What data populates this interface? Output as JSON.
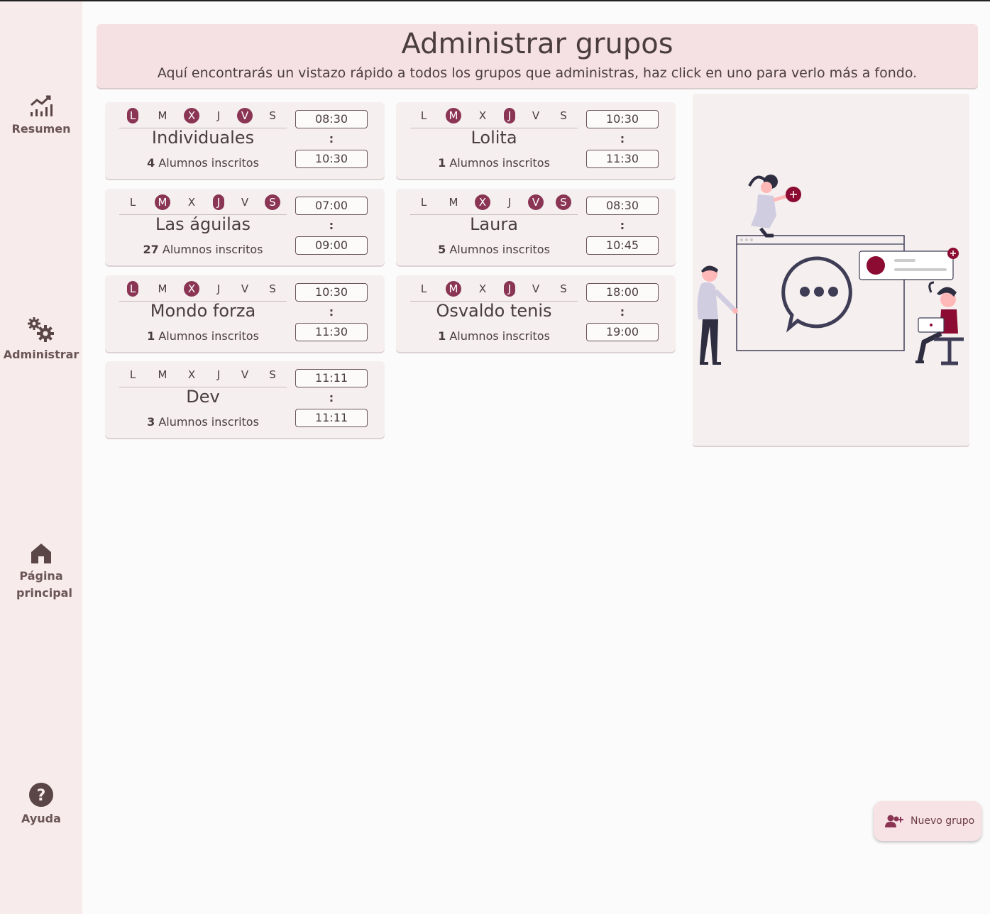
{
  "sidebar": {
    "items": [
      {
        "label": "Resumen",
        "icon": "chart-line-icon"
      },
      {
        "label": "Administrar",
        "icon": "gears-icon"
      },
      {
        "label": "Página principal",
        "icon": "home-icon"
      },
      {
        "label": "Ayuda",
        "icon": "help-icon"
      }
    ]
  },
  "header": {
    "title": "Administrar grupos",
    "subtitle": "Aquí encontrarás un vistazo rápido a todos los grupos que administras, haz click en uno para verlo más a fondo."
  },
  "day_letters": [
    "L",
    "M",
    "X",
    "J",
    "V",
    "S"
  ],
  "groups": [
    {
      "name": "Individuales",
      "count": "4",
      "count_label": "Alumnos inscritos",
      "start": "08:30",
      "sep": ":",
      "end": "10:30",
      "active": [
        true,
        false,
        true,
        false,
        true,
        false
      ]
    },
    {
      "name": "Lolita",
      "count": "1",
      "count_label": "Alumnos inscritos",
      "start": "10:30",
      "sep": ":",
      "end": "11:30",
      "active": [
        false,
        true,
        false,
        true,
        false,
        false
      ]
    },
    {
      "name": "Las águilas",
      "count": "27",
      "count_label": "Alumnos inscritos",
      "start": "07:00",
      "sep": ":",
      "end": "09:00",
      "active": [
        false,
        true,
        false,
        true,
        false,
        true
      ]
    },
    {
      "name": "Laura",
      "count": "5",
      "count_label": "Alumnos inscritos",
      "start": "08:30",
      "sep": ":",
      "end": "10:45",
      "active": [
        false,
        false,
        true,
        false,
        true,
        true
      ]
    },
    {
      "name": "Mondo forza",
      "count": "1",
      "count_label": "Alumnos inscritos",
      "start": "10:30",
      "sep": ":",
      "end": "11:30",
      "active": [
        true,
        false,
        true,
        false,
        false,
        false
      ]
    },
    {
      "name": "Osvaldo tenis",
      "count": "1",
      "count_label": "Alumnos inscritos",
      "start": "18:00",
      "sep": ":",
      "end": "19:00",
      "active": [
        false,
        true,
        false,
        true,
        false,
        false
      ]
    },
    {
      "name": "Dev",
      "count": "3",
      "count_label": "Alumnos inscritos",
      "start": "11:11",
      "sep": ":",
      "end": "11:11",
      "active": [
        false,
        false,
        false,
        false,
        false,
        false
      ]
    }
  ],
  "fab": {
    "label": "Nuevo grupo",
    "icon": "add-user-icon"
  },
  "colors": {
    "accent": "#8a3553",
    "sidebar": "#f7ebeb",
    "header": "#f5e1e3",
    "card": "#f5efef",
    "text": "#4a3d3f"
  }
}
